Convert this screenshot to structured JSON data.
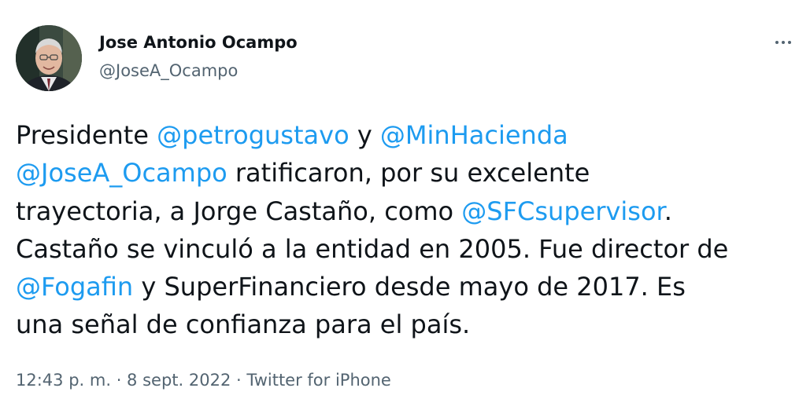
{
  "author": {
    "display_name": "Jose Antonio Ocampo",
    "handle": "@JoseA_Ocampo",
    "avatar_icon": "profile-photo"
  },
  "more_icon": "more-horizontal-icon",
  "tweet": {
    "lines": [
      [
        {
          "type": "text",
          "text": "Presidente "
        },
        {
          "type": "mention",
          "text": "@petrogustavo"
        },
        {
          "type": "text",
          "text": " y "
        },
        {
          "type": "mention",
          "text": "@MinHacienda"
        }
      ],
      [
        {
          "type": "mention",
          "text": "@JoseA_Ocampo"
        },
        {
          "type": "text",
          "text": " ratificaron, por su excelente"
        }
      ],
      [
        {
          "type": "text",
          "text": "trayectoria, a Jorge Castaño, como "
        },
        {
          "type": "mention",
          "text": "@SFCsupervisor"
        },
        {
          "type": "text",
          "text": "."
        }
      ],
      [
        {
          "type": "text",
          "text": "Castaño se vinculó a la entidad en 2005. Fue director de"
        }
      ],
      [
        {
          "type": "mention",
          "text": "@Fogafin"
        },
        {
          "type": "text",
          "text": " y SuperFinanciero desde mayo de 2017. Es"
        }
      ],
      [
        {
          "type": "text",
          "text": "una señal de confianza para el país."
        }
      ]
    ]
  },
  "meta": {
    "time": "12:43 p. m.",
    "separator": " · ",
    "date": "8 sept. 2022",
    "source": "Twitter for iPhone"
  },
  "colors": {
    "text": "#0f1419",
    "secondary": "#536471",
    "mention": "#1d9bf0",
    "background": "#ffffff"
  }
}
